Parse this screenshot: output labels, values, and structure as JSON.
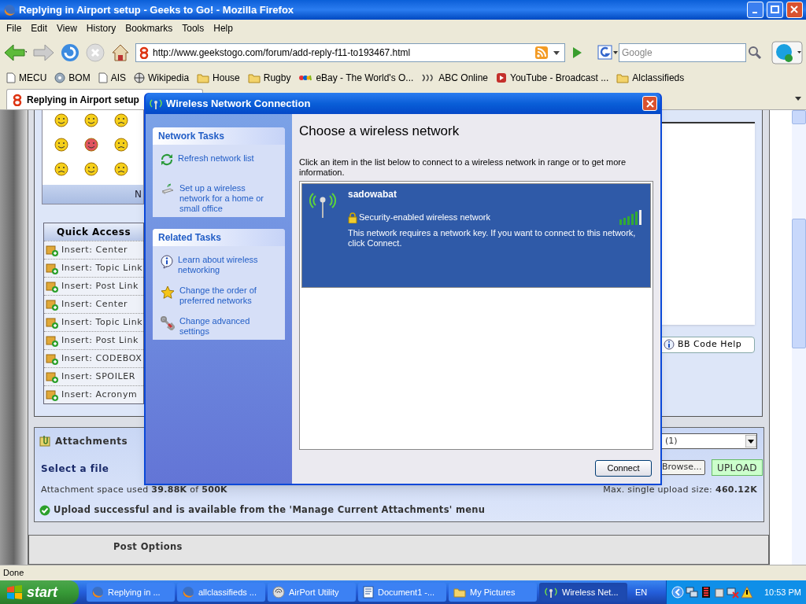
{
  "window": {
    "title": "Replying in Airport setup - Geeks to Go! - Mozilla Firefox"
  },
  "menu": [
    "File",
    "Edit",
    "View",
    "History",
    "Bookmarks",
    "Tools",
    "Help"
  ],
  "toolbar": {
    "url": "http://www.geekstogo.com/forum/add-reply-f11-to193467.html",
    "search_placeholder": "Google"
  },
  "bookmarks": [
    {
      "label": "MECU",
      "kind": "page"
    },
    {
      "label": "BOM",
      "kind": "disc"
    },
    {
      "label": "AIS",
      "kind": "page"
    },
    {
      "label": "Wikipedia",
      "kind": "wiki"
    },
    {
      "label": "House",
      "kind": "folder"
    },
    {
      "label": "Rugby",
      "kind": "folder"
    },
    {
      "label": "eBay - The World's O...",
      "kind": "ebay"
    },
    {
      "label": "ABC Online",
      "kind": "abc"
    },
    {
      "label": "YouTube - Broadcast ...",
      "kind": "youtube"
    },
    {
      "label": "Alclassifieds",
      "kind": "folder"
    }
  ],
  "tabs": [
    {
      "label": "Replying in Airport setup",
      "selected": true
    }
  ],
  "forum": {
    "emoticons_footer": "N",
    "quick_access": {
      "title": "Quick Access",
      "items": [
        "Insert: Center",
        "Insert: Topic Link",
        "Insert: Post Link",
        "Insert: Center",
        "Insert: Topic Link",
        "Insert: Post Link",
        "Insert: CODEBOX",
        "Insert: SPOILER",
        "Insert: Acronym"
      ]
    },
    "bb_code_help": "BB Code Help",
    "attachments": {
      "title": "Attachments",
      "select_label": "Select a file",
      "space_used": "Attachment space used **39.88K** of **500K**",
      "select_value": "(1)",
      "browse": "Browse...",
      "upload": "UPLOAD",
      "max_size": "Max. single upload size: **460.12K**",
      "success": "Upload successful and is available from the 'Manage Current Attachments' menu"
    },
    "post_options": {
      "title": "Post Options"
    }
  },
  "dialog": {
    "title": "Wireless Network Connection",
    "network_tasks": {
      "title": "Network Tasks",
      "items": [
        {
          "label": "Refresh network list",
          "kind": "refresh"
        },
        {
          "label": "Set up a wireless network for a home or small office",
          "kind": "router"
        }
      ]
    },
    "related_tasks": {
      "title": "Related Tasks",
      "items": [
        {
          "label": "Learn about wireless networking",
          "kind": "info"
        },
        {
          "label": "Change the order of preferred networks",
          "kind": "star"
        },
        {
          "label": "Change advanced settings",
          "kind": "tools"
        }
      ]
    },
    "heading": "Choose a wireless network",
    "instructions": "Click an item in the list below to connect to a wireless network in range or to get more information.",
    "networks": [
      {
        "name": "sadowabat",
        "security": "Security-enabled wireless network",
        "message": "This network requires a network key. If you want to connect to this network, click Connect.",
        "selected": true
      }
    ],
    "connect": "Connect"
  },
  "status_bar": "Done",
  "taskbar": {
    "start": "start",
    "items": [
      {
        "label": "Replying in ...",
        "kind": "firefox",
        "selected": false
      },
      {
        "label": "allclassifieds ...",
        "kind": "firefox",
        "selected": false
      },
      {
        "label": "AirPort Utility",
        "kind": "airport",
        "selected": false
      },
      {
        "label": "Document1 -...",
        "kind": "word",
        "selected": false
      },
      {
        "label": "My Pictures",
        "kind": "folder",
        "selected": false
      },
      {
        "label": "Wireless Net...",
        "kind": "wireless",
        "selected": true
      }
    ],
    "language": "EN",
    "clock": "10:53 PM"
  }
}
